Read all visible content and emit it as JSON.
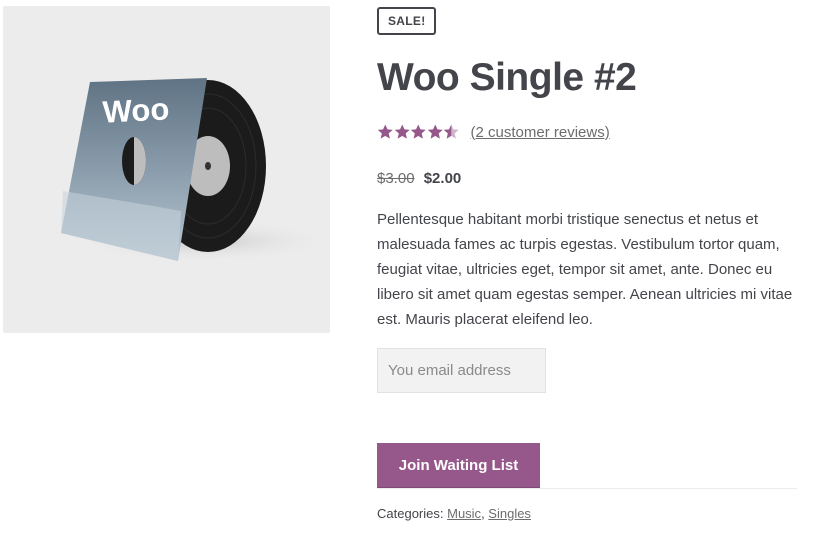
{
  "product": {
    "sale_badge": "SALE!",
    "title": "Woo Single #2",
    "image_logo_text": "Woo",
    "rating": {
      "value": 4.5,
      "max": 5,
      "star_color": "#96588a",
      "empty_star_color": "#cfb6ca"
    },
    "reviews_link": "(2 customer reviews)",
    "price": {
      "regular": "$3.00",
      "sale": "$2.00"
    },
    "description": "Pellentesque habitant morbi tristique senectus et netus et malesuada fames ac turpis egestas. Vestibulum tortor quam, feugiat vitae, ultricies eget, tempor sit amet, ante. Donec eu libero sit amet quam egestas semper. Aenean ultricies mi vitae est. Mauris placerat eleifend leo."
  },
  "waitlist": {
    "email_placeholder": "You email address",
    "email_value": "",
    "button_label": "Join Waiting List",
    "button_color": "#96588a"
  },
  "meta": {
    "categories_label": "Categories:",
    "categories": [
      "Music",
      "Singles"
    ],
    "separator": ", "
  }
}
